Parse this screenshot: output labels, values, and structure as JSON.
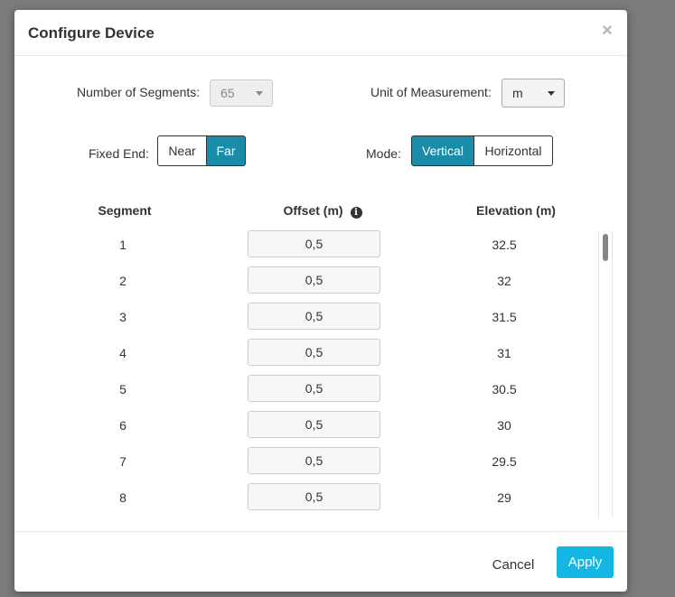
{
  "dialog": {
    "title": "Configure Device",
    "close_glyph": "×"
  },
  "form": {
    "segments_label": "Number of Segments:",
    "segments_value": "65",
    "unit_label": "Unit of Measurement:",
    "unit_value": "m",
    "fixed_end_label": "Fixed End:",
    "fixed_end_options": [
      "Near",
      "Far"
    ],
    "fixed_end_selected": "Far",
    "mode_label": "Mode:",
    "mode_options": [
      "Vertical",
      "Horizontal"
    ],
    "mode_selected": "Vertical"
  },
  "table": {
    "headers": {
      "segment": "Segment",
      "offset": "Offset (m)",
      "elevation": "Elevation (m)"
    },
    "info_glyph": "i",
    "rows": [
      {
        "segment": "1",
        "offset": "0,5",
        "elevation": "32.5"
      },
      {
        "segment": "2",
        "offset": "0,5",
        "elevation": "32"
      },
      {
        "segment": "3",
        "offset": "0,5",
        "elevation": "31.5"
      },
      {
        "segment": "4",
        "offset": "0,5",
        "elevation": "31"
      },
      {
        "segment": "5",
        "offset": "0,5",
        "elevation": "30.5"
      },
      {
        "segment": "6",
        "offset": "0,5",
        "elevation": "30"
      },
      {
        "segment": "7",
        "offset": "0,5",
        "elevation": "29.5"
      },
      {
        "segment": "8",
        "offset": "0,5",
        "elevation": "29"
      }
    ]
  },
  "footer": {
    "cancel_label": "Cancel",
    "apply_label": "Apply"
  },
  "colors": {
    "accent": "#1a8caa",
    "apply": "#14b6e3",
    "overlay": "#7b7b7b"
  }
}
